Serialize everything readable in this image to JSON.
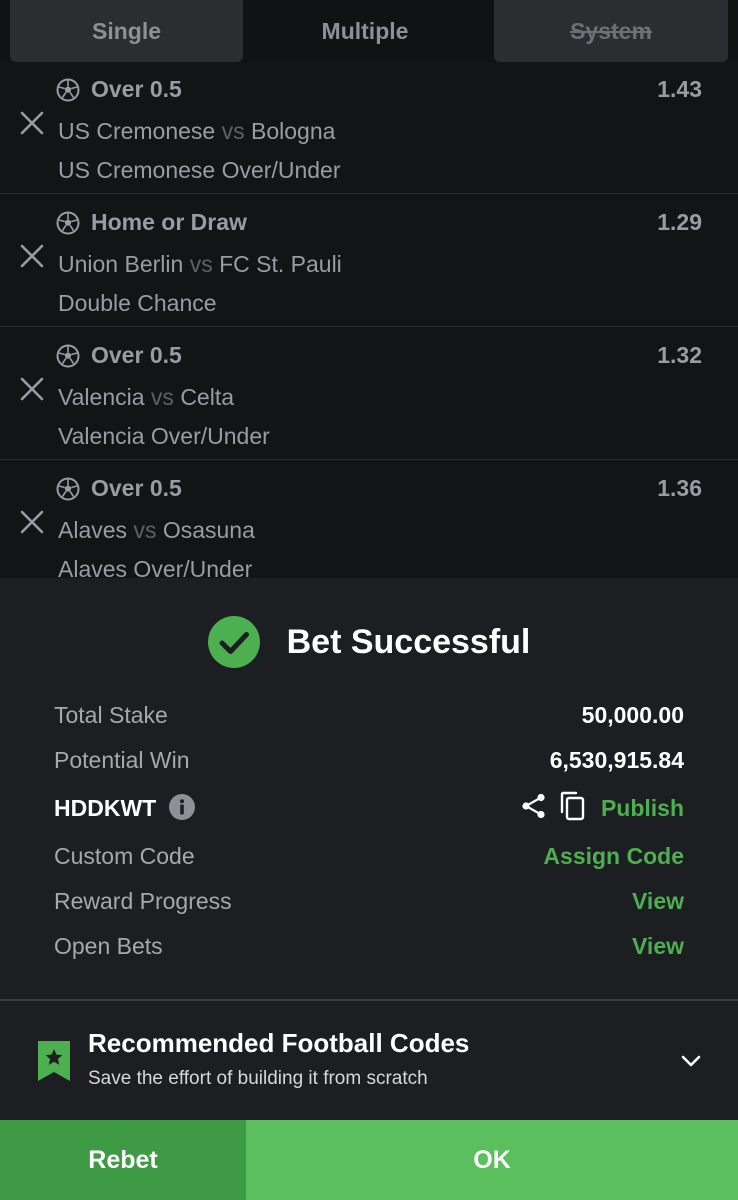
{
  "tabs": {
    "single": "Single",
    "multiple": "Multiple",
    "system": "System"
  },
  "selections": [
    {
      "pick": "Over 0.5",
      "odds": "1.43",
      "home": "US Cremonese",
      "vs": "vs",
      "away": "Bologna",
      "market": "US Cremonese Over/Under"
    },
    {
      "pick": "Home or Draw",
      "odds": "1.29",
      "home": "Union Berlin",
      "vs": "vs",
      "away": "FC St. Pauli",
      "market": "Double Chance"
    },
    {
      "pick": "Over 0.5",
      "odds": "1.32",
      "home": "Valencia",
      "vs": "vs",
      "away": "Celta",
      "market": "Valencia Over/Under"
    },
    {
      "pick": "Over 0.5",
      "odds": "1.36",
      "home": "Alaves",
      "vs": "vs",
      "away": "Osasuna",
      "market": "Alaves Over/Under"
    }
  ],
  "success": {
    "title": "Bet Successful",
    "total_stake_label": "Total Stake",
    "total_stake_value": "50,000.00",
    "potential_win_label": "Potential Win",
    "potential_win_value": "6,530,915.84",
    "booking_code": "HDDKWT",
    "publish_label": "Publish",
    "custom_code_label": "Custom Code",
    "assign_code_label": "Assign Code",
    "reward_progress_label": "Reward Progress",
    "reward_view_label": "View",
    "open_bets_label": "Open Bets",
    "open_bets_view_label": "View"
  },
  "recommended": {
    "title": "Recommended Football Codes",
    "subtitle": "Save the effort of building it from scratch"
  },
  "buttons": {
    "rebet": "Rebet",
    "ok": "OK"
  },
  "icons": {
    "remove": "close-icon",
    "sport": "soccer-ball-icon",
    "success": "check-circle-icon",
    "info": "info-icon",
    "share": "share-icon",
    "copy": "copy-icon",
    "bookmark": "bookmark-star-icon",
    "expand": "chevron-down-icon"
  },
  "colors": {
    "accent_green": "#4caf50",
    "ok_button": "#5bbf5e",
    "rebet_button": "#3f9a45",
    "panel_bg": "#1d1e22",
    "page_bg": "#111214"
  }
}
